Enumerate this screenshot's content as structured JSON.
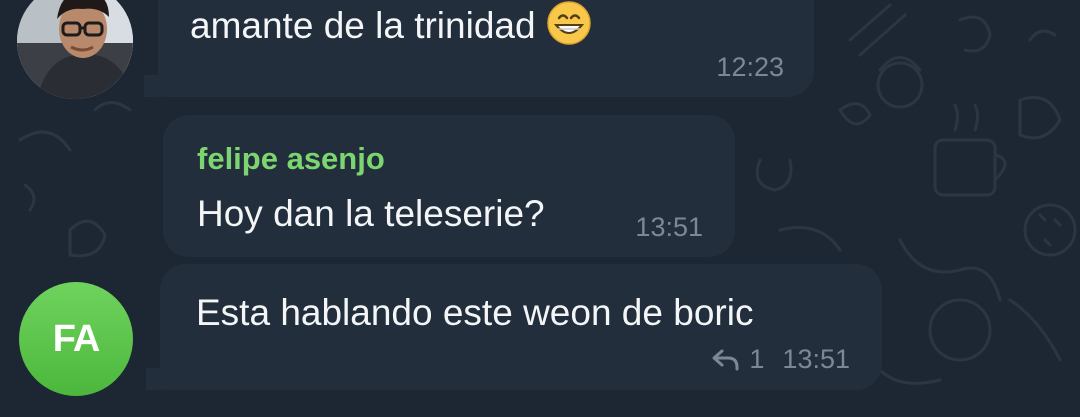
{
  "messages": [
    {
      "text": "amante de la trinidad",
      "emoji": "grinning-face-with-smiling-eyes",
      "time": "12:23"
    },
    {
      "sender": "felipe asenjo",
      "text": "Hoy dan la teleserie?",
      "time": "13:51"
    },
    {
      "text": "Esta hablando este weon de boric",
      "reply_count": "1",
      "time": "13:51"
    }
  ],
  "avatars": {
    "photo": "user-photo-avatar",
    "initials": "FA"
  },
  "colors": {
    "background": "#1d2733",
    "bubble": "#232e3c",
    "sender_name": "#7bd66f",
    "timestamp": "#7b8895",
    "avatar_green": "#5cc44a"
  }
}
